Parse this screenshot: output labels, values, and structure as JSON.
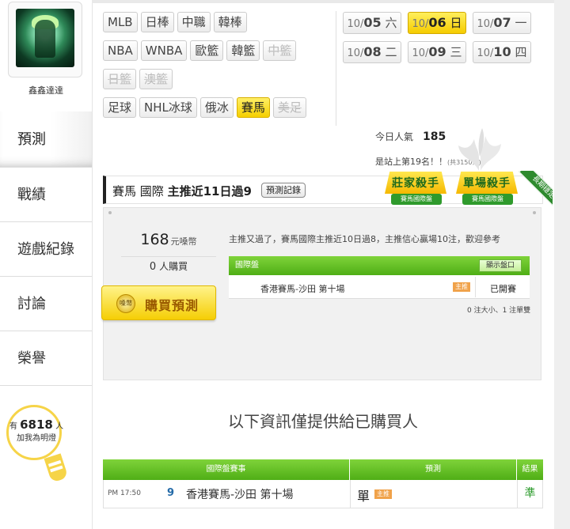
{
  "user": {
    "name": "鑫鑫達達"
  },
  "sidebar": {
    "items": [
      {
        "label": "預測",
        "active": true
      },
      {
        "label": "戰績",
        "active": false
      },
      {
        "label": "遊戲紀錄",
        "active": false
      },
      {
        "label": "討論",
        "active": false
      },
      {
        "label": "榮譽",
        "active": false
      }
    ],
    "bulb": {
      "prefix": "有",
      "count": "6818",
      "suffix": "人",
      "line2": "加我為明燈"
    }
  },
  "sports": {
    "rows": [
      [
        {
          "label": "MLB",
          "state": "normal"
        },
        {
          "label": "日棒",
          "state": "normal"
        },
        {
          "label": "中職",
          "state": "normal"
        },
        {
          "label": "韓棒",
          "state": "normal"
        }
      ],
      [
        {
          "label": "NBA",
          "state": "normal"
        },
        {
          "label": "WNBA",
          "state": "normal"
        },
        {
          "label": "歐籃",
          "state": "normal"
        },
        {
          "label": "韓籃",
          "state": "normal"
        },
        {
          "label": "中籃",
          "state": "disabled"
        }
      ],
      [
        {
          "label": "日籃",
          "state": "disabled"
        },
        {
          "label": "澳籃",
          "state": "disabled"
        }
      ],
      [
        {
          "label": "足球",
          "state": "normal"
        },
        {
          "label": "NHL冰球",
          "state": "normal"
        },
        {
          "label": "俄冰",
          "state": "normal"
        },
        {
          "label": "賽馬",
          "state": "active"
        },
        {
          "label": "美足",
          "state": "disabled"
        }
      ]
    ]
  },
  "dates": {
    "rows": [
      [
        {
          "month": "10/",
          "day": "05",
          "weekday": "六",
          "active": false
        },
        {
          "month": "10/",
          "day": "06",
          "weekday": "日",
          "active": true
        },
        {
          "month": "10/",
          "day": "07",
          "weekday": "一",
          "active": false
        }
      ],
      [
        {
          "month": "10/",
          "day": "08",
          "weekday": "二",
          "active": false
        },
        {
          "month": "10/",
          "day": "09",
          "weekday": "三",
          "active": false
        },
        {
          "month": "10/",
          "day": "10",
          "weekday": "四",
          "active": false
        }
      ]
    ]
  },
  "stats": {
    "popularity_label": "今日人氣",
    "popularity_value": "185",
    "rank_text": "是站上第19名！！",
    "rank_total": "(共3150人)"
  },
  "title_bar": {
    "sport": "賽馬",
    "region": "國際",
    "headline": "主推近11日過9",
    "record_button": "預測記錄"
  },
  "badges": [
    {
      "title": "莊家殺手",
      "subtitle": "賽馬國際盤"
    },
    {
      "title": "單場殺手",
      "subtitle": "賽馬國際盤"
    }
  ],
  "ribbon": "長期穩定",
  "offer": {
    "price": "168",
    "price_unit": "元嗓幣",
    "buyers_count": "0",
    "buyers_label": "人購買",
    "buy_button": "購買預測",
    "coin_label": "嗓幣"
  },
  "note": "主推又過了，賽馬國際主推近10日過8，主推信心贏場10注，歡迎參考",
  "intl_table": {
    "header": "國際盤",
    "show_button": "顯示盤口",
    "row": {
      "match": "香港賽馬-沙田 第十場",
      "tag": "主推",
      "status": "已開賽"
    },
    "odds_note": "0 注大小、1 注單雙"
  },
  "info_banner": "以下資訊僅提供給已購買人",
  "results_table": {
    "headers": [
      "國際盤賽事",
      "預測",
      "結果"
    ],
    "row": {
      "time": "PM 17:50",
      "number": "9",
      "game": "香港賽馬-沙田 第十場",
      "pick": "單",
      "tag": "主推",
      "result": "準"
    }
  },
  "colors": {
    "accent_green": "#4fae16",
    "highlight_yellow": "#f5cf00"
  }
}
